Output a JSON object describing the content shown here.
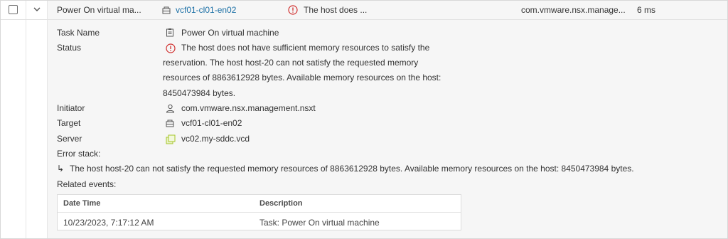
{
  "row": {
    "task_name": "Power On virtual ma...",
    "target": "vcf01-cl01-en02",
    "status": "The host does ...",
    "initiator": "com.vmware.nsx.manage...",
    "duration": "6 ms"
  },
  "details": {
    "task_name_label": "Task Name",
    "task_name": "Power On virtual machine",
    "status_label": "Status",
    "status_lines": [
      "The host does not have sufficient memory resources to satisfy the",
      "reservation. The host host-20 can not satisfy the requested memory",
      "resources of 8863612928 bytes. Available memory resources on the host:",
      "8450473984 bytes."
    ],
    "initiator_label": "Initiator",
    "initiator": "com.vmware.nsx.management.nsxt",
    "target_label": "Target",
    "target": "vcf01-cl01-en02",
    "server_label": "Server",
    "server": "vc02.my-sddc.vcd",
    "error_stack_label": "Error stack:",
    "error_stack_arrow": "↳",
    "error_stack": "The host host-20 can not satisfy the requested memory resources of 8863612928 bytes. Available memory resources on the host: 8450473984 bytes.",
    "related_events_label": "Related events:"
  },
  "events_table": {
    "columns": [
      "Date Time",
      "Description"
    ],
    "rows": [
      [
        "10/23/2023, 7:17:12 AM",
        "Task: Power On virtual machine"
      ]
    ]
  },
  "colors": {
    "link": "#1a6fa5",
    "error": "#d0302f",
    "server_icon": "#a7c62b"
  },
  "icons": [
    "checkbox",
    "chevron-down-icon",
    "host-icon",
    "error-icon",
    "clipboard-icon",
    "user-icon",
    "server-icon"
  ]
}
